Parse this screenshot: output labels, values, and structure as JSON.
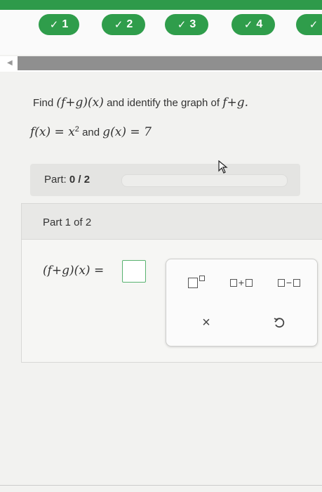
{
  "steps": [
    {
      "label": "1"
    },
    {
      "label": "2"
    },
    {
      "label": "3"
    },
    {
      "label": "4"
    }
  ],
  "colors": {
    "accent": "#2f9d4b",
    "answer_border": "#58b26f"
  },
  "question": {
    "prefix": "Find",
    "expr1": "(f+g)(x)",
    "middle": "and identify the graph of",
    "expr2": "f+g."
  },
  "given": {
    "f_expr": "f(x) = x",
    "f_exp": "2",
    "conj": "and",
    "g_expr": "g(x) = 7"
  },
  "part_progress": {
    "label": "Part:",
    "value": "0 / 2",
    "fraction": 0
  },
  "part_card": {
    "header": "Part 1 of 2",
    "answer_label": "(f+g)(x) ="
  },
  "tools": {
    "clear_symbol": "×",
    "undo_icon": "undo-icon",
    "plus": "+",
    "minus": "−"
  }
}
